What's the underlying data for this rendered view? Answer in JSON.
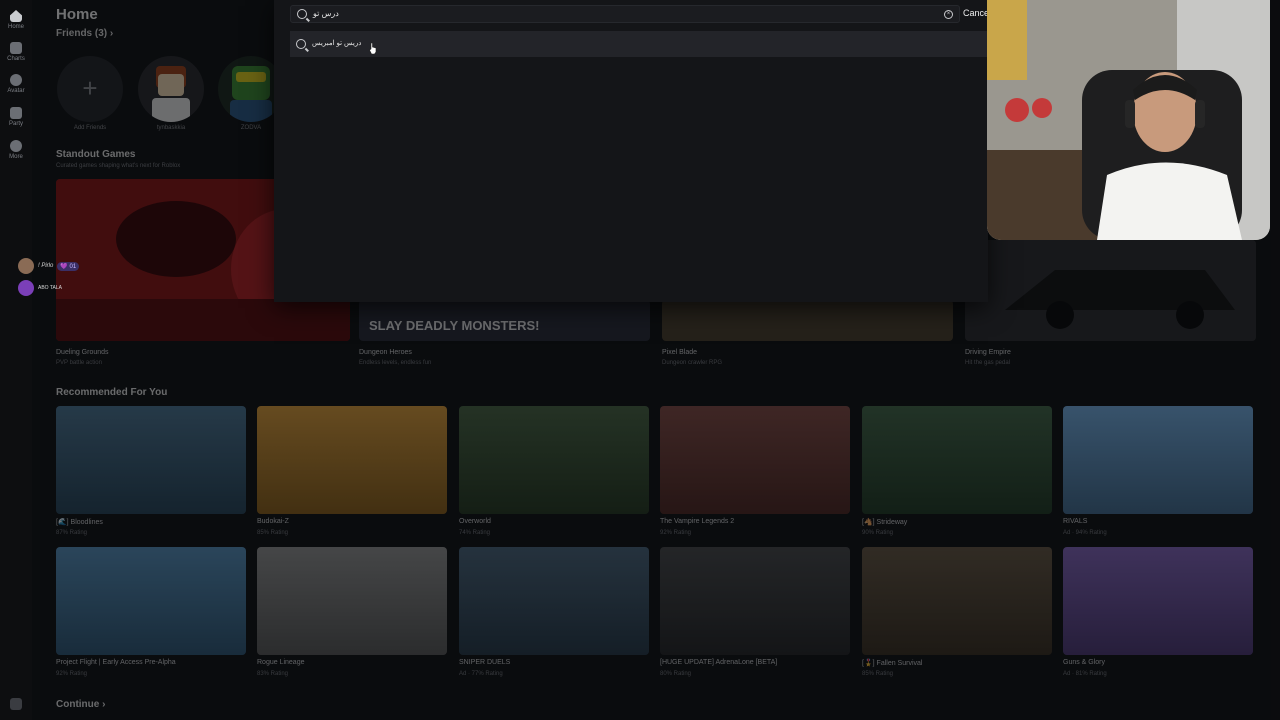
{
  "nav": {
    "items": [
      {
        "label": "Home",
        "icon": "home-icon"
      },
      {
        "label": "Charts",
        "icon": "charts-icon"
      },
      {
        "label": "Avatar",
        "icon": "avatar-icon"
      },
      {
        "label": "Party",
        "icon": "party-icon"
      },
      {
        "label": "More",
        "icon": "more-icon"
      }
    ]
  },
  "page": {
    "title": "Home",
    "friends_label": "Friends (3) ›",
    "friends": [
      {
        "name": "Add Friends"
      },
      {
        "name": "tynbaskkia"
      },
      {
        "name": "ZODVA"
      }
    ]
  },
  "search": {
    "query": "درس تو",
    "suggestion": "دريس تو امبريس",
    "cancel_label": "Cancel"
  },
  "standout": {
    "title": "Standout Games",
    "subtitle": "Curated games shaping what's next for Roblox",
    "banner_text": "SLAY DEADLY MONSTERS!",
    "games": [
      {
        "name": "Dueling Grounds",
        "sub": "PVP battle action"
      },
      {
        "name": "Dungeon Heroes",
        "sub": "Endless levels, endless fun"
      },
      {
        "name": "Pixel Blade",
        "sub": "Dungeon crawler RPG"
      },
      {
        "name": "Driving Empire",
        "sub": "Hit the gas pedal"
      }
    ]
  },
  "recommended": {
    "title": "Recommended For You",
    "row1": [
      {
        "name": "[🌊] Bloodlines",
        "rating": "87% Rating",
        "color": "#3e6b8c"
      },
      {
        "name": "Budokai-Z",
        "rating": "85% Rating",
        "color": "#d8952c"
      },
      {
        "name": "Overworld",
        "rating": "74% Rating",
        "color": "#3c5a37"
      },
      {
        "name": "The Vampire Legends 2",
        "rating": "92% Rating",
        "color": "#7a3e38"
      },
      {
        "name": "[🐴] Strideway",
        "rating": "90% Rating",
        "color": "#355c3c"
      },
      {
        "name": "RIVALS",
        "rating": "Ad · 94% Rating",
        "color": "#6aa8e0"
      }
    ],
    "row2": [
      {
        "name": "Project Flight | Early Access Pre-Alpha",
        "rating": "92% Rating",
        "color": "#4a88b8"
      },
      {
        "name": "Rogue Lineage",
        "rating": "83% Rating",
        "color": "#8a8a8a"
      },
      {
        "name": "SNIPER DUELS",
        "rating": "Ad · 77% Rating",
        "color": "#3d5a73"
      },
      {
        "name": "[HUGE UPDATE] AdrenaLone [BETA]",
        "rating": "80% Rating",
        "color": "#3a3b3e"
      },
      {
        "name": "[🎖️] Fallen Survival",
        "rating": "85% Rating",
        "color": "#5a4a36"
      },
      {
        "name": "Guns & Glory",
        "rating": "Ad · 81% Rating",
        "color": "#7a5ab8"
      }
    ],
    "labels": {
      "project_flight": "PROJECT FLIGHT",
      "rogue": "Rogue Lineage",
      "strideway": "STRIDEWAY"
    }
  },
  "continue": {
    "title": "Continue ›"
  },
  "chat": [
    {
      "name": "! Pirlo",
      "badge": "💜 01"
    },
    {
      "name": "ABO TALA"
    }
  ],
  "colors": {
    "background": "#111215",
    "overlay": "#141518",
    "accent": "#e23b3b"
  }
}
